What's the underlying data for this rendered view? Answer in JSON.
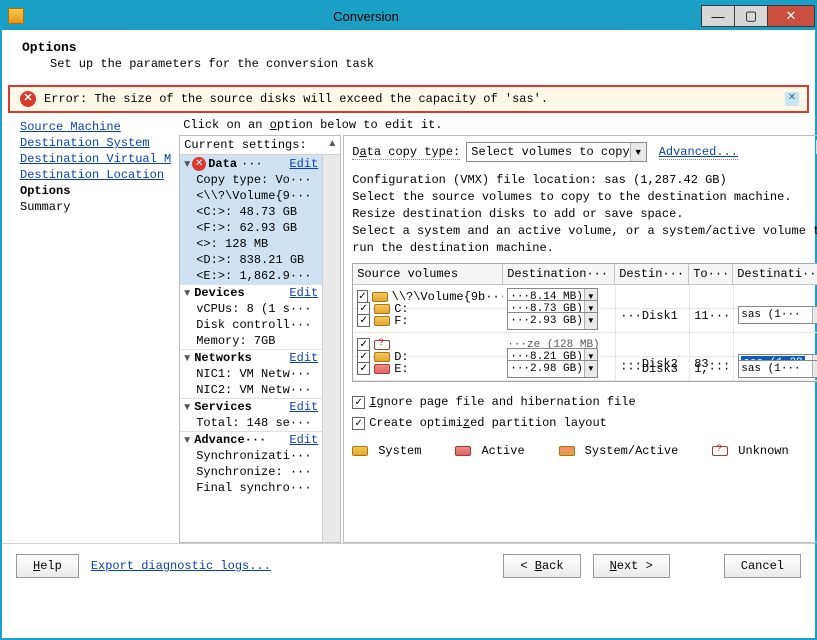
{
  "window": {
    "title": "Conversion"
  },
  "header": {
    "title": "Options",
    "subtitle": "Set up the parameters for the conversion task"
  },
  "error": {
    "text": "Error: The size of the source disks will exceed the capacity of 'sas'."
  },
  "nav": {
    "items": [
      "Source Machine",
      "Destination System",
      "Destination Virtual M",
      "Destination Location",
      "Options",
      "Summary"
    ]
  },
  "mid": {
    "hint_pre": "Click on an ",
    "hint_u": "o",
    "hint_post": "ption below to edit it.",
    "heading": "Current settings:",
    "data": {
      "label": "Data",
      "dots": "···",
      "edit": "Edit",
      "rows": [
        "Copy type: Vo···",
        "<\\\\?\\Volume{9···",
        "<C:>: 48.73 GB",
        "<F:>: 62.93 GB",
        "<>: 128 MB",
        "<D:>: 838.21 GB",
        "<E:>: 1,862.9···"
      ]
    },
    "devices": {
      "label": "Devices",
      "edit": "Edit",
      "rows": [
        "vCPUs: 8 (1 s···",
        "Disk controll···",
        "Memory: 7GB"
      ]
    },
    "networks": {
      "label": "Networks",
      "edit": "Edit",
      "rows": [
        "NIC1: VM Netw···",
        "NIC2: VM Netw···"
      ]
    },
    "services": {
      "label": "Services",
      "edit": "Edit",
      "rows": [
        "Total: 148 se···"
      ]
    },
    "advanced": {
      "label": "Advance···",
      "edit": "Edit",
      "rows": [
        "Synchronizati···",
        "Synchronize: ···",
        "Final synchro···"
      ]
    }
  },
  "right": {
    "dct_pre": "D",
    "dct_u": "a",
    "dct_post": "ta copy type:",
    "dct_value": "Select volumes to copy",
    "adv_pre": "A",
    "adv_u": "d",
    "adv_post": "vanced...",
    "conf": "Configuration (VMX) file location: sas (1,287.42 GB)",
    "l1": "Select the source volumes to copy to the destination machine.",
    "l2": "Resize destination disks to add or save space.",
    "l3": "Select a system and an active volume, or a system/active volume to run the destination machine.",
    "headers": [
      "Source volumes",
      "Destination···",
      "Destin···",
      "To···",
      "Destinati···"
    ],
    "rows": [
      {
        "chk": true,
        "icon": "yellow",
        "src": "\\\\?\\Volume{9b···",
        "dest": "···8.14 MB)",
        "disk": "···Disk1",
        "to": "11···",
        "store": "sas (1···"
      },
      {
        "chk": true,
        "icon": "yellow",
        "src": "C:",
        "dest": "···8.73 GB)",
        "disk": "",
        "to": "",
        "store": ""
      },
      {
        "chk": true,
        "icon": "yellow",
        "src": "F:",
        "dest": "···2.93 GB)",
        "disk": "",
        "to": "",
        "store": ""
      },
      {
        "chk": true,
        "icon": "q",
        "src": "",
        "dest": "···ze (128 MB)",
        "disk": "···Disk2",
        "to": "83···",
        "store": "sas (1,28",
        "hi": true,
        "gray": true
      },
      {
        "chk": true,
        "icon": "yellow",
        "src": "D:",
        "dest": "···8.21 GB)",
        "disk": "",
        "to": "",
        "store": ""
      },
      {
        "chk": true,
        "icon": "red",
        "src": "E:",
        "dest": "···2.98 GB)",
        "disk": "···Disk3",
        "to": "1,···",
        "store": "sas (1···"
      }
    ],
    "chk1_pre": "",
    "chk1_u": "I",
    "chk1_post": "gnore page file and hibernation file",
    "chk2_pre": "Create optimi",
    "chk2_u": "z",
    "chk2_post": "ed partition layout",
    "legend": [
      "System",
      "Active",
      "System/Active",
      "Unknown"
    ]
  },
  "footer": {
    "help_u": "H",
    "help": "elp",
    "export": "Export diagnostic logs...",
    "back_pre": "< ",
    "back_u": "B",
    "back_post": "ack",
    "next_u": "N",
    "next_post": "ext >",
    "cancel": "Cancel"
  }
}
